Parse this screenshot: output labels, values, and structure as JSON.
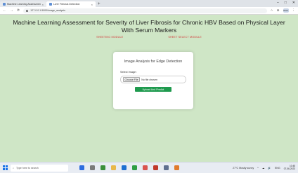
{
  "browser": {
    "tabs": [
      {
        "title": "Machine Learning Assessmen...",
        "active": false
      },
      {
        "title": "Liver Fibrosis Detection",
        "active": true
      }
    ],
    "new_tab": "+",
    "window_controls": [
      "–",
      "□",
      "✕"
    ],
    "nav": [
      "←",
      "→",
      "⟳"
    ],
    "url": "127.0.0.1:5000/image_analysis",
    "toolbar_icons": [
      "☆",
      "⊕",
      "⋮"
    ],
    "profile": "Work"
  },
  "page": {
    "title_line1": "Machine Learning Assessment for Severity of Liver Fibrosis for Chronic HBV Based on Physical Layer",
    "title_line2": "With Serum Markers",
    "nav_links": [
      "SHEETING MODULE",
      "SHEET SELECT MODULE"
    ],
    "card": {
      "title": "Image Analysis for Edge Detection",
      "field_label": "Select Image :",
      "choose_label": "Choose File",
      "file_status": "No file chosen",
      "submit_label": "Upload And Predict"
    }
  },
  "taskbar": {
    "search_placeholder": "Type here to search",
    "apps": [
      "#2d6cdf",
      "#7a7a7a",
      "#3a8f3a",
      "#e8b84a",
      "#1d6fd1",
      "#2f9e44",
      "#d9534f",
      "#c0392b",
      "#5f6f8f",
      "#e07b2c"
    ],
    "weather": "27°C Mostly sunny",
    "tray": [
      "^",
      "☁",
      "🔊",
      "ENG"
    ],
    "time": "10:45",
    "date": "07-06-2023"
  }
}
